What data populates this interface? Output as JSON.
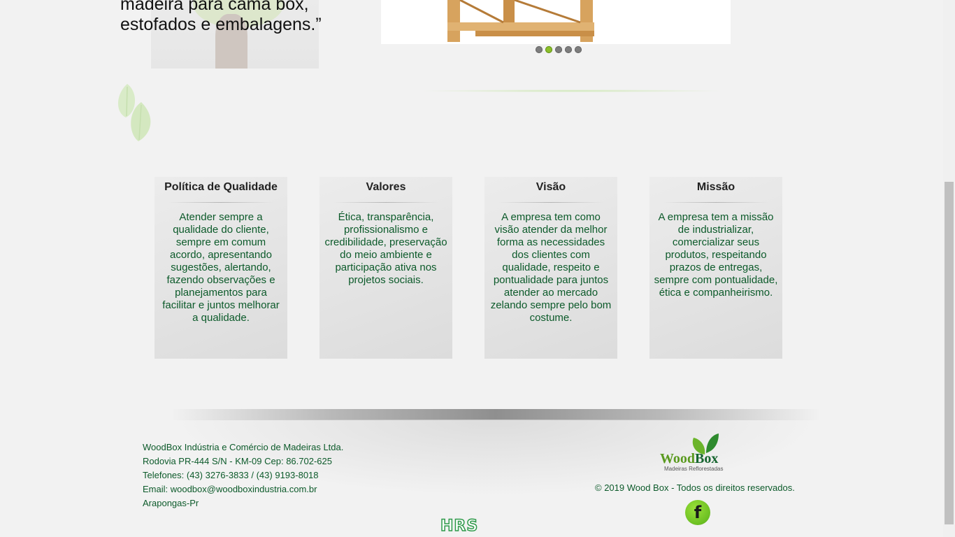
{
  "hero": {
    "quote": "madeira para cama box, estofados e embalagens.”"
  },
  "slider": {
    "dots_total": 5,
    "active_dot": 2
  },
  "cards": [
    {
      "title": "Política de Qualidade",
      "text": "Atender sempre a qualidade do cliente, sempre em comum acordo, apresentando sugestões, alertando, fazendo observações e planejamentos para facilitar e juntos melhorar a qualidade."
    },
    {
      "title": "Valores",
      "text": "Ética, transparência, profissionalismo e credibilidade, preservação do meio ambiente e participação ativa nos projetos sociais."
    },
    {
      "title": "Visão",
      "text": "A empresa tem como visão atender da melhor forma as necessidades dos clientes com qualidade, respeito e pontualidade para juntos atender ao mercado zelando sempre pelo bom costume."
    },
    {
      "title": "Missão",
      "text": "A empresa tem a missão de industrializar, comercializar seus produtos, respeitando prazos de entregas, sempre com pontualidade, ética e companheirismo."
    }
  ],
  "footer": {
    "company": "WoodBox Indústria e Comércio de Madeiras Ltda.",
    "address": "Rodovia PR-444 S/N - KM-09 Cep: 86.702-625",
    "phones": "Telefones: (43) 3276-3833 / (43) 9193-8018",
    "email": "Email: woodbox@woodboxindustria.com.br",
    "city": "Arapongas-Pr",
    "logo_word_1": "Wood",
    "logo_word_2": "Box",
    "logo_sub": "Madeiras Reflorestadas",
    "copyright": "© 2019 Wood Box - Todos os direitos reservados.",
    "facebook_glyph": "f",
    "credit": "HRS"
  },
  "colors": {
    "text_green": "#0c5a2a",
    "accent_green": "#8cbf2a",
    "background": "#f2f2f2"
  },
  "icons": [
    "leaf-icon",
    "facebook-icon",
    "tree-icon"
  ]
}
